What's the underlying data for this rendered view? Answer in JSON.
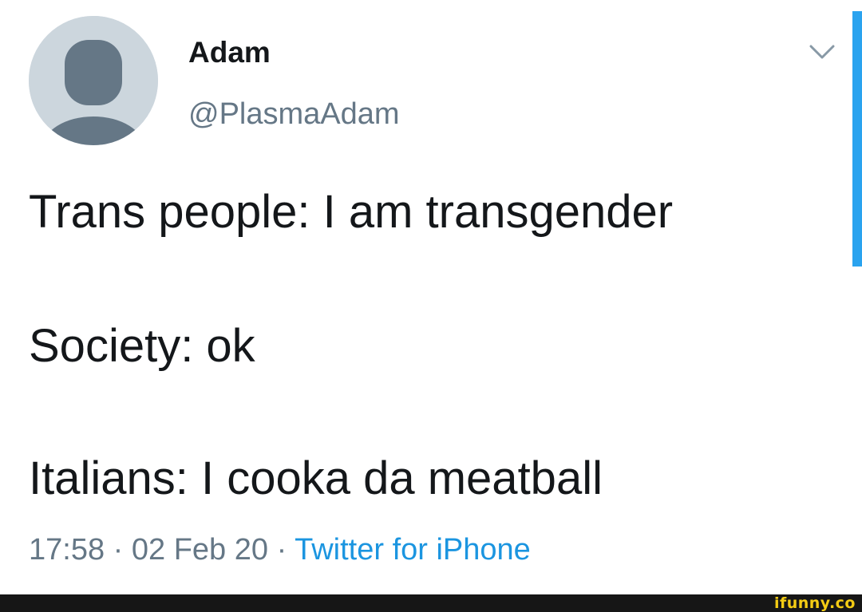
{
  "user": {
    "display_name": "Adam",
    "handle": "@PlasmaAdam",
    "avatar_icon": "default-profile-icon"
  },
  "tweet": {
    "lines": [
      "Trans people: I am transgender",
      "Society: ok",
      "Italians: I cooka da meatball"
    ]
  },
  "meta": {
    "time": "17:58",
    "separator_1": " · ",
    "date": "02 Feb 20",
    "separator_2": " · ",
    "source": "Twitter for iPhone"
  },
  "menu": {
    "icon": "chevron-down-icon"
  },
  "watermark": {
    "text": "ifunny.co"
  },
  "colors": {
    "text_primary": "#14171a",
    "text_secondary": "#657786",
    "link": "#1b95e0",
    "avatar_bg": "#ccd6dd",
    "avatar_fg": "#657786",
    "accent_bar": "#2aa3ef",
    "footer_bg": "#161616",
    "watermark": "#f4cc14"
  }
}
